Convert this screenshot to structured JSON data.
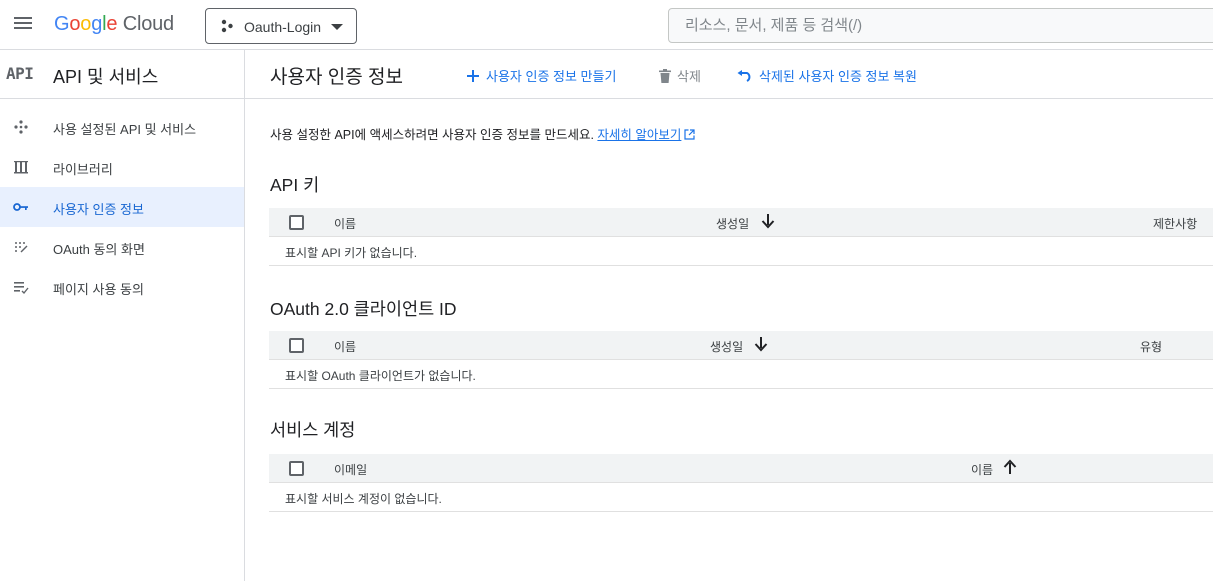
{
  "topbar": {
    "logo": {
      "google": [
        "G",
        "o",
        "o",
        "g",
        "l",
        "e"
      ],
      "cloud": "Cloud"
    },
    "project_name": "Oauth-Login",
    "search_placeholder": "리소스, 문서, 제품 등 검색(/)"
  },
  "sidebar": {
    "badge": "API",
    "title": "API 및 서비스",
    "items": [
      {
        "label": "사용 설정된 API 및 서비스",
        "icon": "move-icon",
        "active": false
      },
      {
        "label": "라이브러리",
        "icon": "library-icon",
        "active": false
      },
      {
        "label": "사용자 인증 정보",
        "icon": "key-icon",
        "active": true
      },
      {
        "label": "OAuth 동의 화면",
        "icon": "consent-icon",
        "active": false
      },
      {
        "label": "페이지 사용 동의",
        "icon": "page-usage-icon",
        "active": false
      }
    ]
  },
  "header": {
    "title": "사용자 인증 정보",
    "create_label": "사용자 인증 정보 만들기",
    "delete_label": "삭제",
    "restore_label": "삭제된 사용자 인증 정보 복원"
  },
  "intro": {
    "text": "사용 설정한 API에 액세스하려면 사용자 인증 정보를 만드세요.",
    "link": "자세히 알아보기"
  },
  "api_keys": {
    "title": "API 키",
    "columns": {
      "name": "이름",
      "created": "생성일",
      "restrictions": "제한사항"
    },
    "empty": "표시할 API 키가 없습니다."
  },
  "oauth_clients": {
    "title": "OAuth 2.0 클라이언트 ID",
    "columns": {
      "name": "이름",
      "created": "생성일",
      "type": "유형"
    },
    "empty": "표시할 OAuth 클라이언트가 없습니다."
  },
  "service_accounts": {
    "title": "서비스 계정",
    "columns": {
      "email": "이메일",
      "name": "이름"
    },
    "empty": "표시할 서비스 계정이 없습니다."
  },
  "colors": {
    "accent": "#1a73e8",
    "active_bg": "#e8f0fe",
    "header_bg": "#f1f3f4",
    "border": "#dadce0"
  }
}
